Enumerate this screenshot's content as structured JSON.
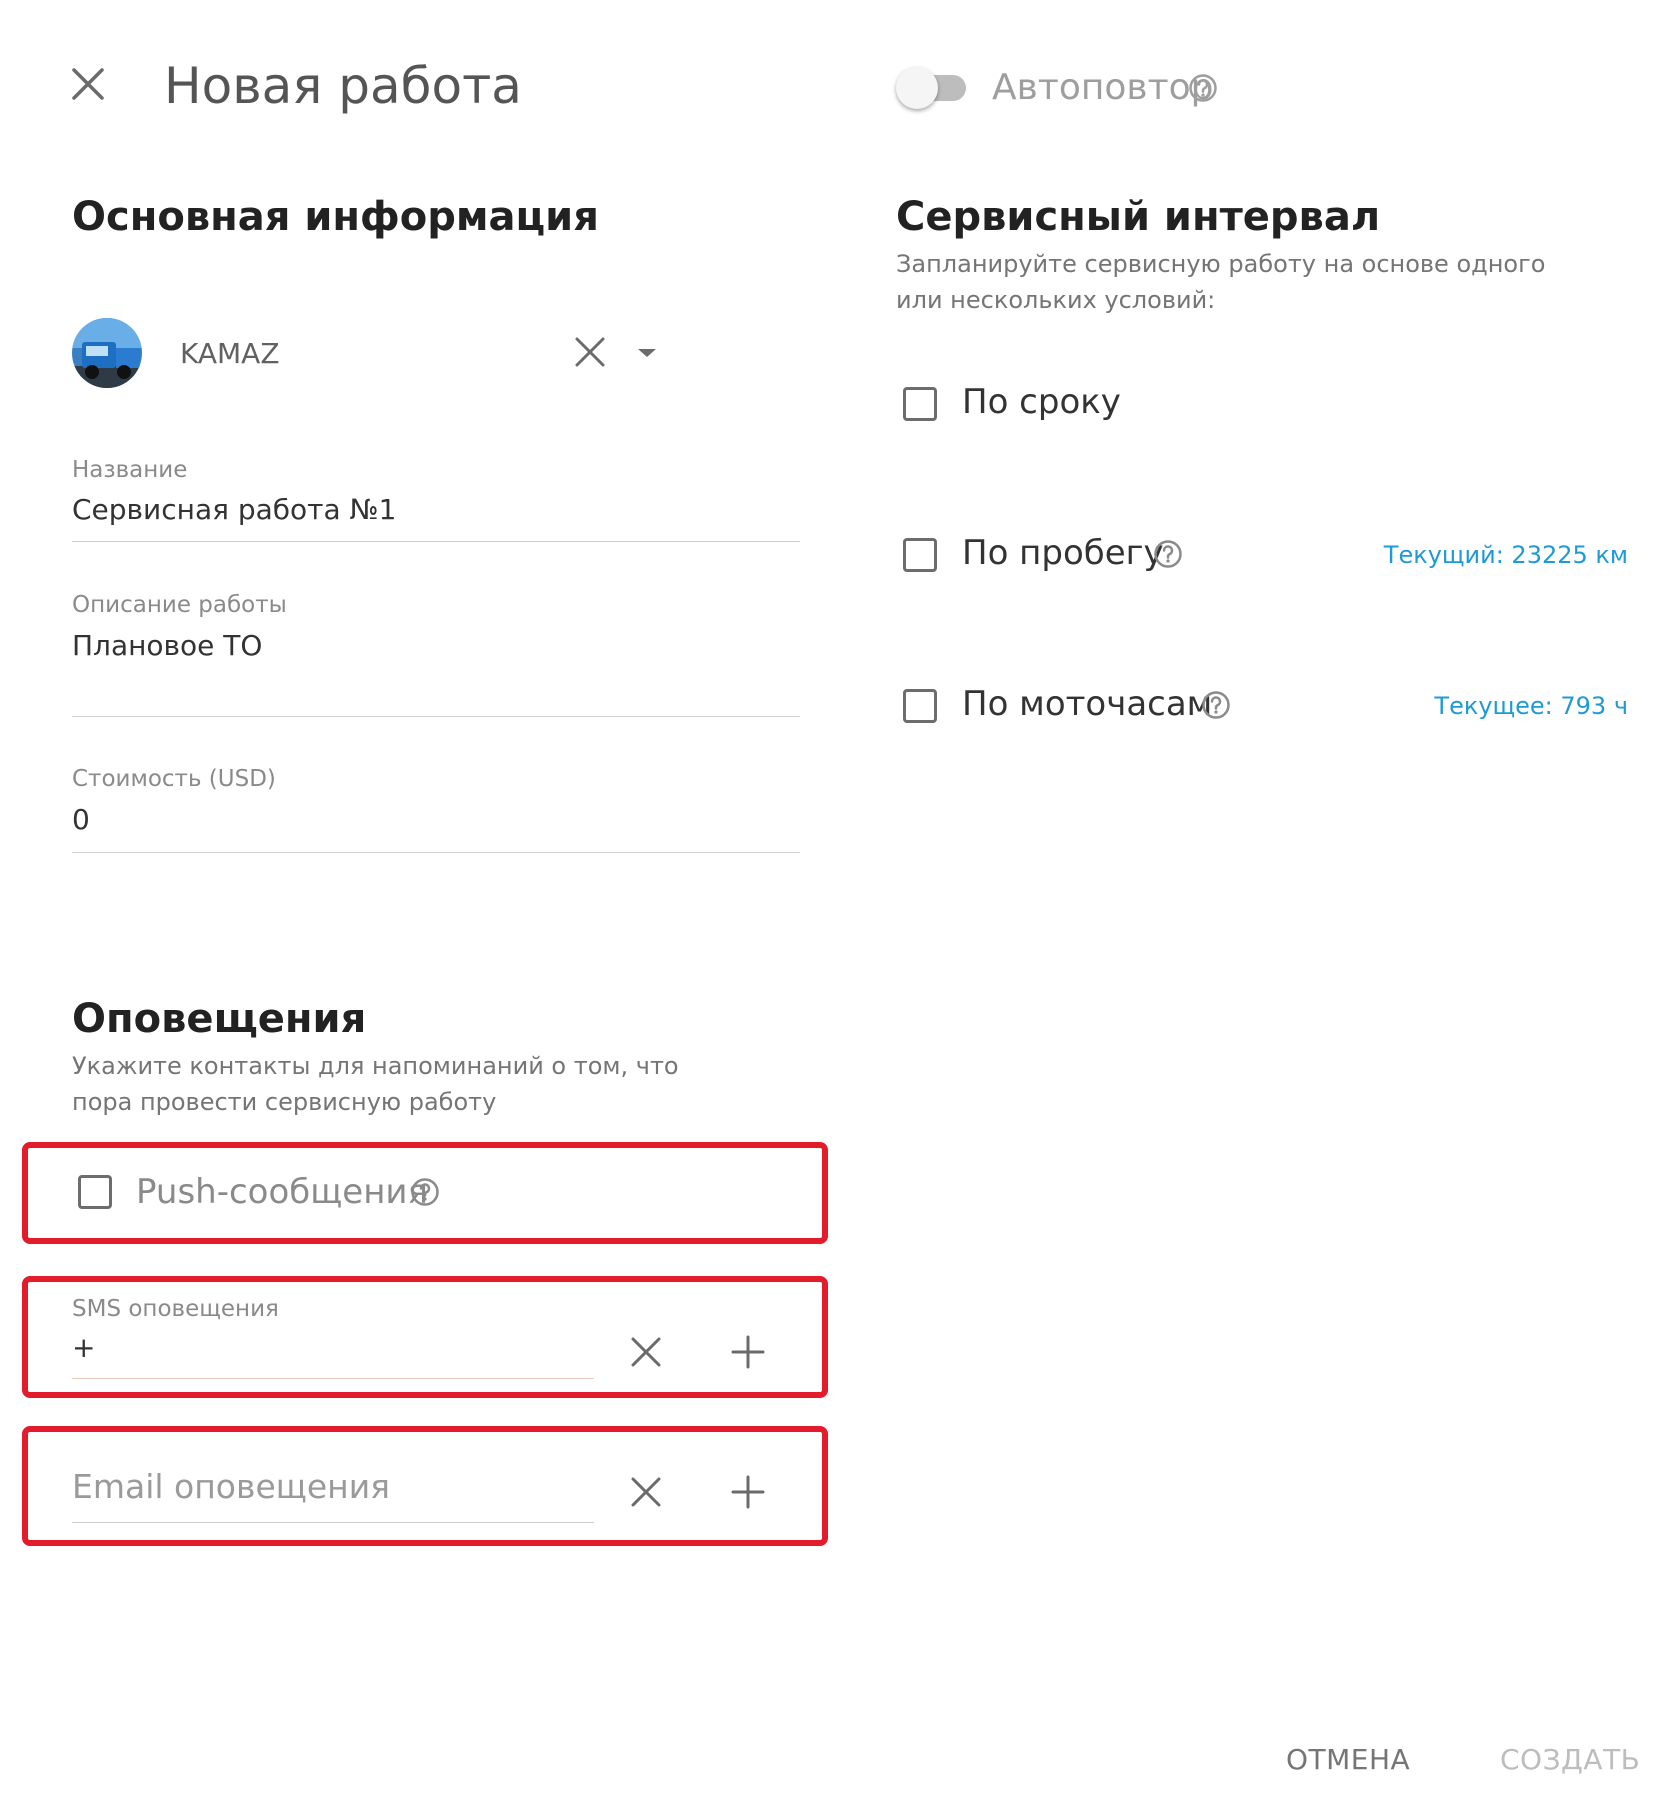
{
  "header": {
    "title": "Новая работа",
    "autorepeat_label": "Автоповтор",
    "autorepeat_on": false
  },
  "main_info": {
    "title": "Основная информация",
    "vehicle": {
      "name": "KAMAZ"
    },
    "name_field": {
      "label": "Название",
      "value": "Сервисная работа №1"
    },
    "description_field": {
      "label": "Описание работы",
      "value": "Плановое ТО"
    },
    "cost_field": {
      "label": "Стоимость (USD)",
      "value": "0"
    }
  },
  "service_interval": {
    "title": "Сервисный интервал",
    "description": "Запланируйте сервисную работу на основе одного или нескольких условий:",
    "conditions": [
      {
        "label": "По сроку",
        "checked": false
      },
      {
        "label": "По пробегу",
        "checked": false,
        "current": "Текущий: 23225 км"
      },
      {
        "label": "По моточасам",
        "checked": false,
        "current": "Текущее: 793 ч"
      }
    ]
  },
  "notifications": {
    "title": "Оповещения",
    "description": "Укажите контакты для напоминаний о том, что пора провести сервисную работу",
    "push_label": "Push-сообщения",
    "sms": {
      "label": "SMS оповещения",
      "value": "+"
    },
    "email": {
      "placeholder": "Email оповещения"
    }
  },
  "footer": {
    "cancel_label": "ОТМЕНА",
    "create_label": "СОЗДАТЬ"
  },
  "colors": {
    "accent_blue": "#1e9ad6",
    "highlight_red": "#e31b2b",
    "disabled_text": "#bdbdbd"
  },
  "icons": [
    "close-icon",
    "help-icon",
    "chevron-down-icon",
    "plus-icon",
    "truck-avatar"
  ]
}
